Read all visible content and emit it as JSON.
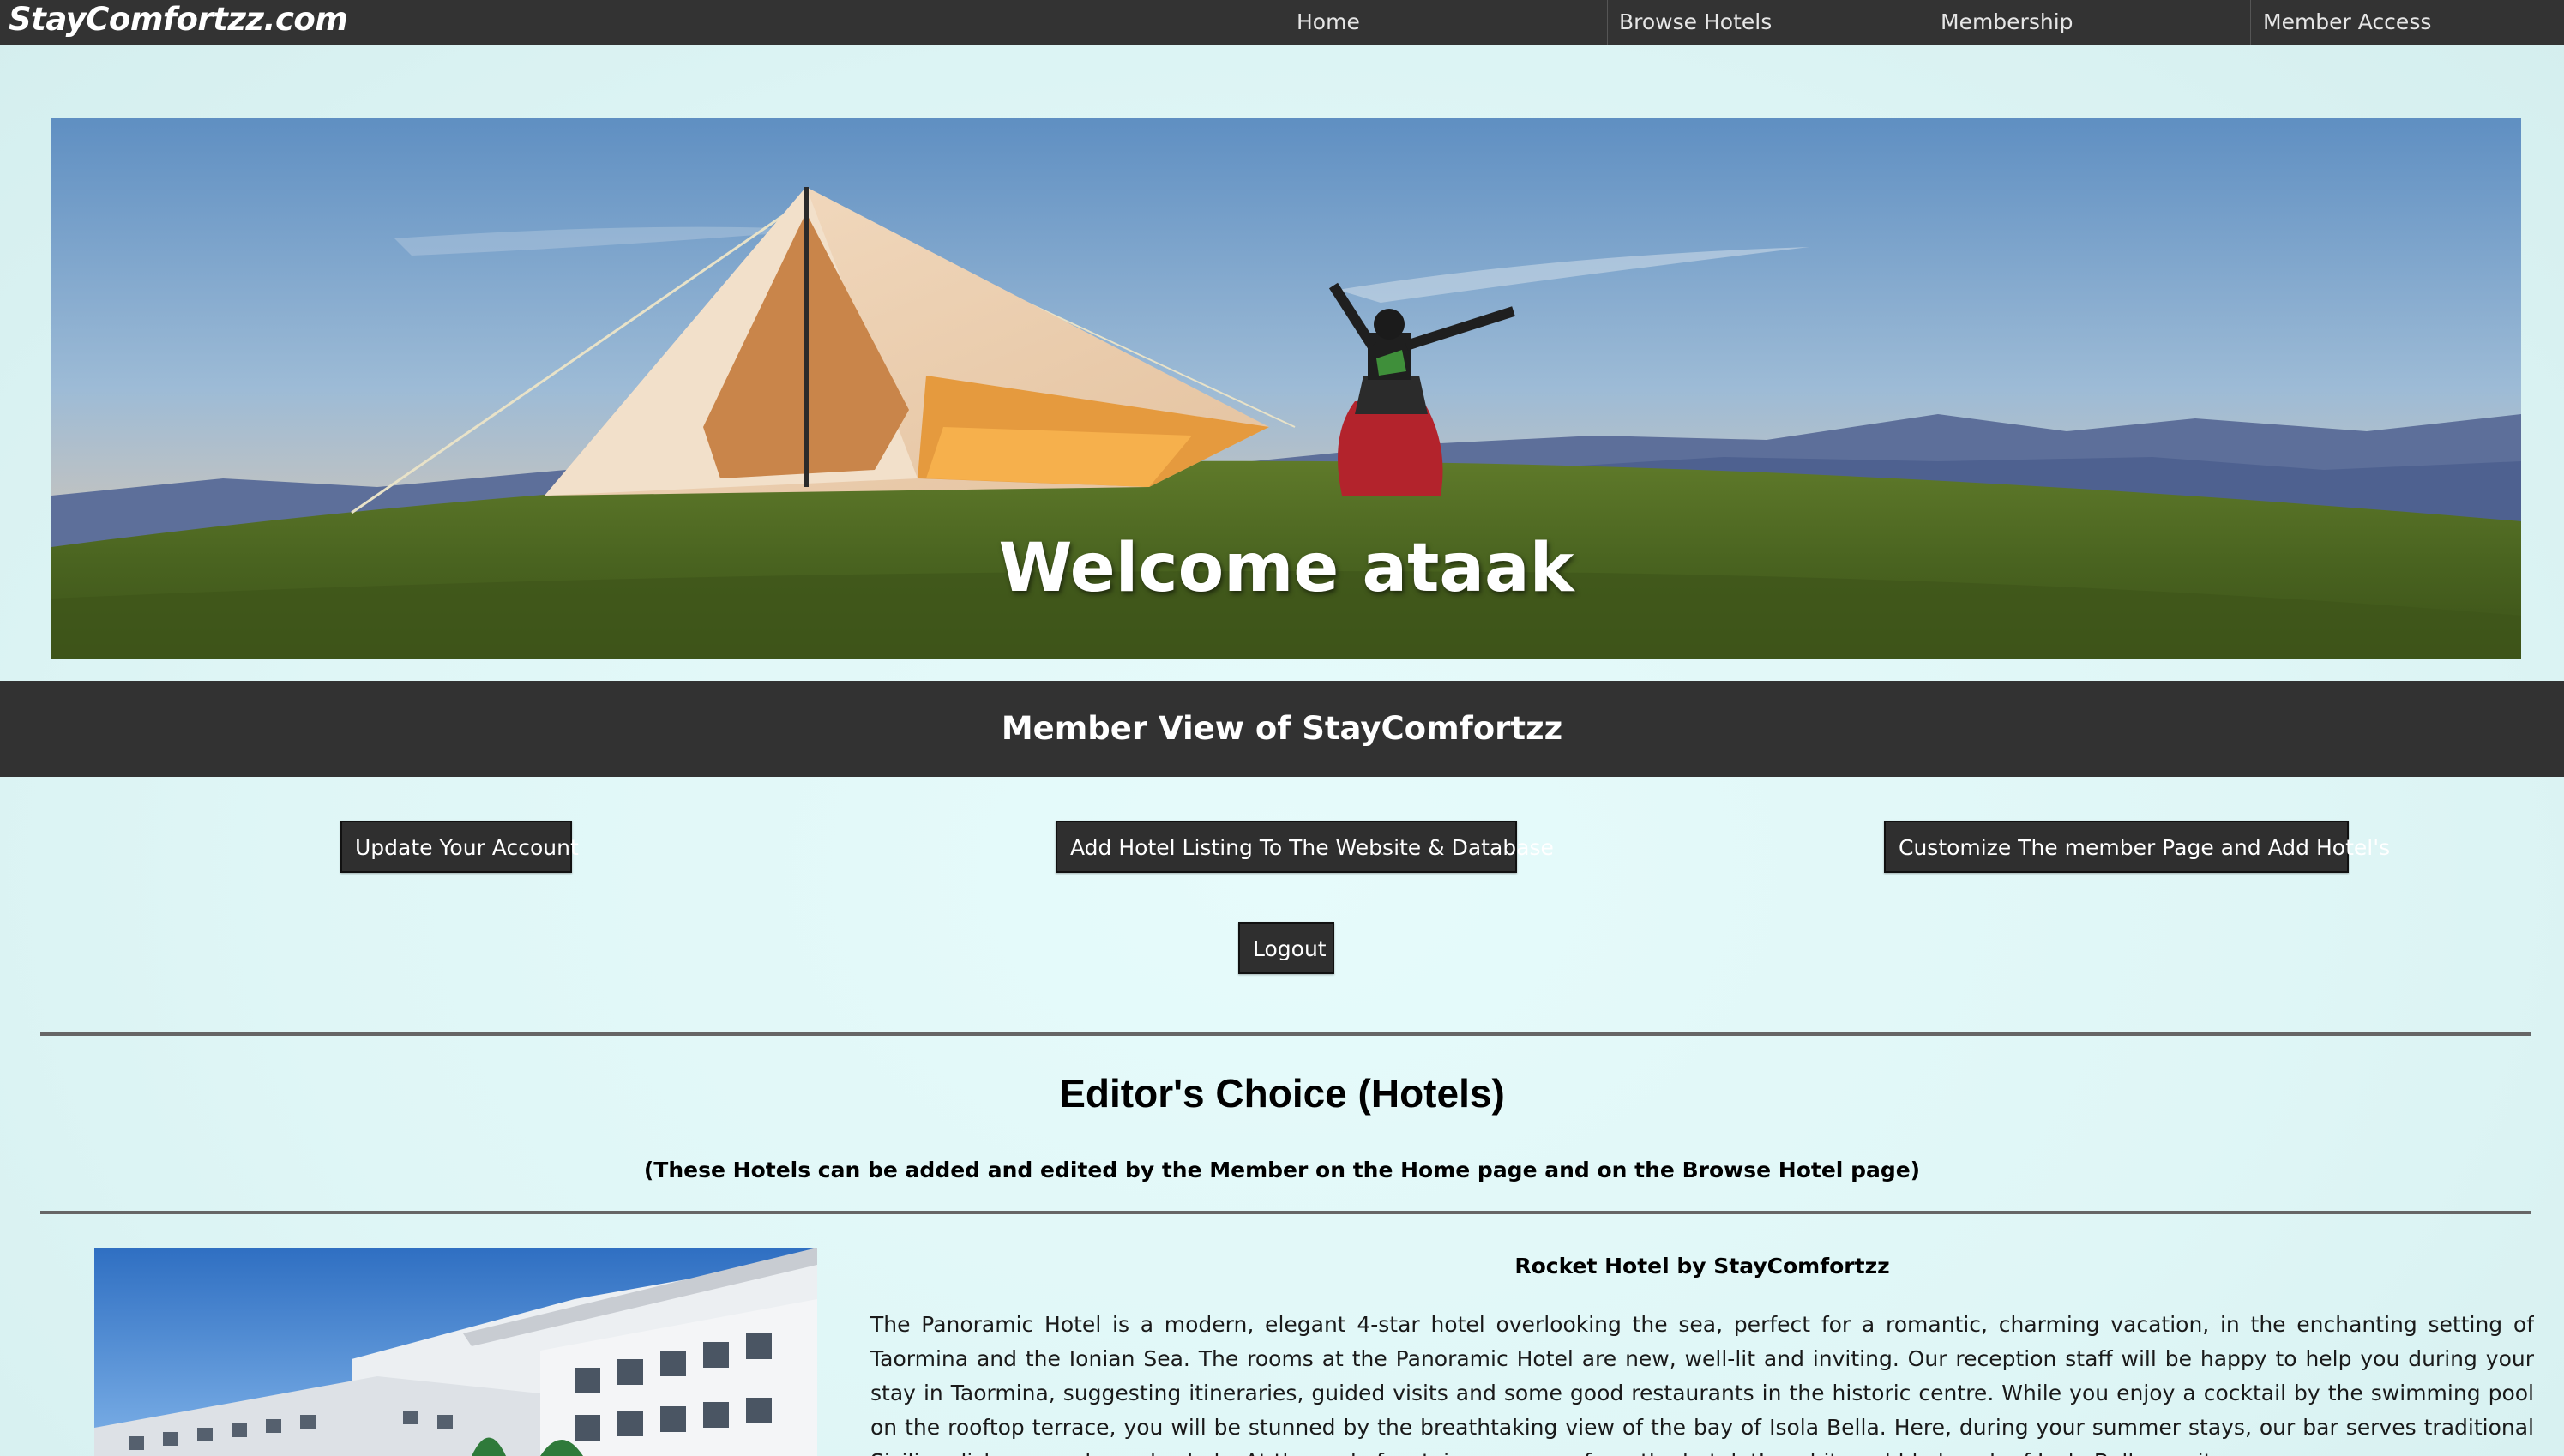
{
  "nav": {
    "brand": "StayComfortzz.com",
    "items": [
      {
        "label": "Home"
      },
      {
        "label": "Browse Hotels"
      },
      {
        "label": "Membership"
      },
      {
        "label": "Member Access"
      }
    ]
  },
  "hero": {
    "title": "Welcome ataak"
  },
  "member_bar": {
    "title": "Member View of StayComfortzz"
  },
  "actions": {
    "update_account": "Update Your Account",
    "add_hotel": "Add Hotel Listing To The Website & Database",
    "customize": "Customize The member Page and Add Hotel's",
    "logout": "Logout"
  },
  "editors_choice": {
    "title": "Editor's Choice (Hotels)",
    "subtitle": "(These Hotels can be added and edited by the Member on the Home page and on the Browse Hotel page)"
  },
  "hotel": {
    "name": "Rocket Hotel by StayComfortzz",
    "description": "The Panoramic Hotel is a modern, elegant 4-star hotel overlooking the sea, perfect for a romantic, charming vacation, in the enchanting setting of Taormina and the Ionian Sea. The rooms at the Panoramic Hotel are new, well-lit and inviting. Our reception staff will be happy to help you during your stay in Taormina, suggesting itineraries, guided visits and some good restaurants in the historic centre. While you enjoy a cocktail by the swimming pool on the rooftop terrace, you will be stunned by the breathtaking view of the bay of Isola Bella. Here, during your summer stays, our bar serves traditional Sicilian dishes, snacks and salads. At the end of a stairway across from the hotel, the white pebble beach of Isola Bella awaits you."
  },
  "colors": {
    "nav_bg": "#333333",
    "member_bar_bg": "#323232",
    "button_bg": "#2f2f2f",
    "page_bg": "#dff6f6"
  }
}
